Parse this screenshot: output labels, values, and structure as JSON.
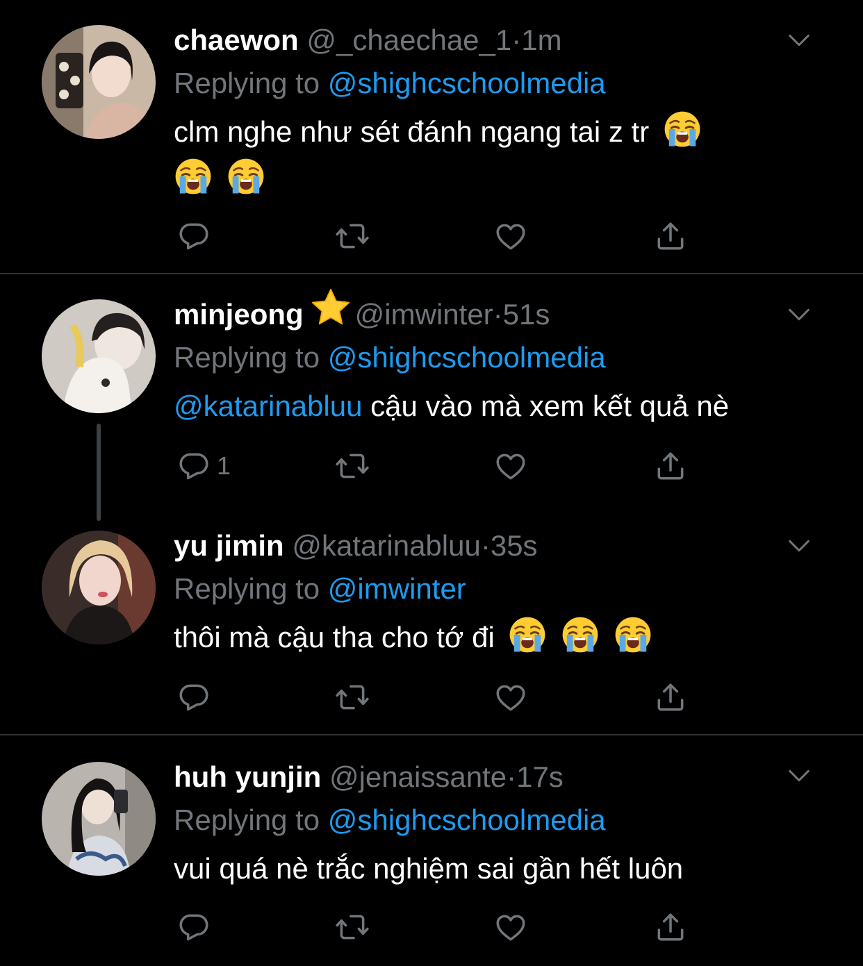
{
  "replying_prefix": "Replying to",
  "icons": {
    "reply": "reply-bubble-icon",
    "retweet": "retweet-icon",
    "like": "heart-icon",
    "share": "share-icon",
    "more": "chevron-down-icon",
    "verified": "star-emoji",
    "emoji": "loudly-crying-face-emoji"
  },
  "colors": {
    "background": "#000000",
    "text": "#ffffff",
    "secondary": "#71767b",
    "mention": "#1d9bf0",
    "divider": "#2f3336"
  },
  "tweets": [
    {
      "name": "chaewon",
      "handle": "@_chaechae_1",
      "separator": "·",
      "time": "1m",
      "replying_to": "@shighcschoolmedia",
      "text": "clm nghe như sét đánh ngang tai z tr",
      "emoji_count": 3,
      "reply_count": ""
    },
    {
      "name": "minjeong",
      "handle": "@imwinter",
      "separator": "·",
      "time": "51s",
      "replying_to": "@shighcschoolmedia",
      "text_mention": "@katarinabluu",
      "text": " cậu vào mà xem kết quả nè",
      "reply_count": "1"
    },
    {
      "name": "yu jimin",
      "handle": "@katarinabluu",
      "separator": "·",
      "time": "35s",
      "replying_to": "@imwinter",
      "text": "thôi mà cậu tha cho tớ đi",
      "emoji_count": 3,
      "reply_count": ""
    },
    {
      "name": "huh yunjin",
      "handle": "@jenaissante",
      "separator": "·",
      "time": "17s",
      "replying_to": "@shighcschoolmedia",
      "text": "vui quá nè trắc nghiệm sai gần hết luôn",
      "reply_count": ""
    }
  ]
}
